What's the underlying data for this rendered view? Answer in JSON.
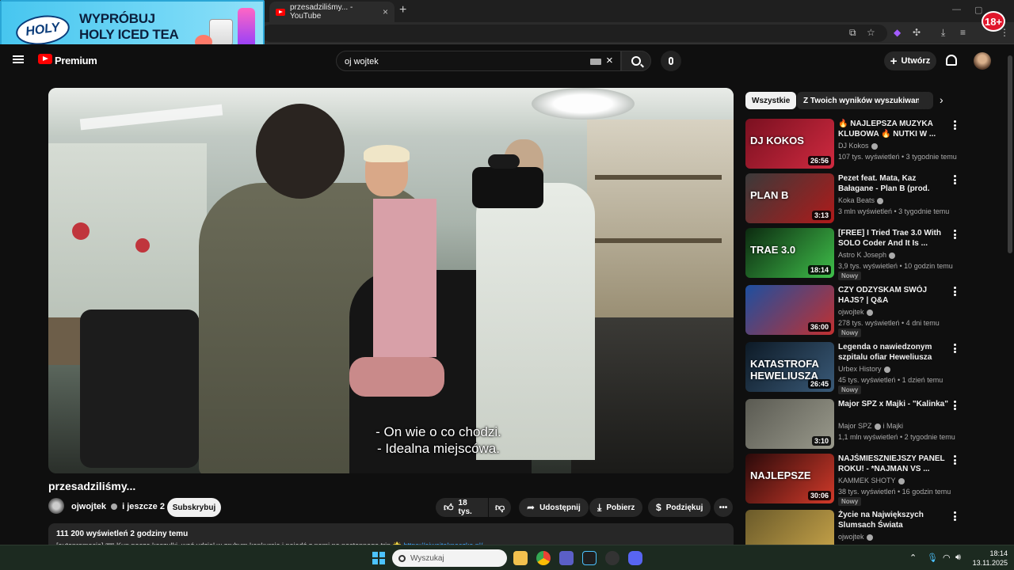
{
  "browser": {
    "tab_title": "przesadziliśmy... - YouTube",
    "new_tab": "+",
    "tab_close": "×"
  },
  "ad": {
    "logo_text": "HOLY",
    "headline_line1": "WYPRÓBUJ",
    "headline_line2": "HOLY ICED TEA",
    "age_badge": "18+"
  },
  "header": {
    "brand_label": "Premium",
    "search": {
      "value": "oj wojtek"
    },
    "create_label": "Utwórz"
  },
  "video": {
    "subtitles": [
      "- On wie o co chodzi.",
      "- Idealna miejscówa."
    ],
    "title": "przesadziliśmy...",
    "channel": "ojwojtek",
    "collab_suffix": "i jeszcze 2",
    "subscribe_label": "Subskrybuj",
    "likes": "18 tys.",
    "share_label": "Udostępnij",
    "download_label": "Pobierz",
    "thanks_label": "Podziękuj",
    "description_stats": "111 200 wyświetleń  2 godziny temu",
    "description_text": "[autopromocja] 🎟 Kup paczę koszulki, weź udział w grubym konkursie i pojedź z nami na następnego trip 🌟",
    "description_link": "https://ojwojtekpaczka.pl/"
  },
  "sidebar": {
    "chips": [
      "Wszystkie",
      "Z Twoich wyników wyszukiwania"
    ],
    "recommendations": [
      {
        "title": "🔥 NAJLEPSZA MUZYKA KLUBOWA 🔥 NUTKI W ...",
        "channel": "DJ Kokos",
        "meta": "107 tys. wyświetleń • 3 tygodnie temu",
        "duration": "26:56",
        "badge": "",
        "thumb_text": "DJ KOKOS",
        "colors": [
          "#7a1020",
          "#d02a40"
        ]
      },
      {
        "title": "Pezet feat. Mata, Kaz Bałagane - Plan B (prod. Pedro, Frenkie G)",
        "channel": "Koka Beats",
        "meta": "3 mln wyświetleń • 3 tygodnie temu",
        "duration": "3:13",
        "badge": "",
        "thumb_text": "PLAN B",
        "colors": [
          "#3a3a3a",
          "#b01a1a"
        ]
      },
      {
        "title": "[FREE] I Tried Trae 3.0 With SOLO Coder And It Is ...",
        "channel": "Astro K Joseph",
        "meta": "3,9 tys. wyświetleń • 10 godzin temu",
        "duration": "18:14",
        "badge": "Nowy",
        "thumb_text": "TRAE 3.0",
        "colors": [
          "#0c2a10",
          "#3fbf4a"
        ]
      },
      {
        "title": "CZY ODZYSKAM SWÓJ HAJS? | Q&A",
        "channel": "ojwojtek",
        "meta": "278 tys. wyświetleń • 4 dni temu",
        "duration": "36:00",
        "badge": "Nowy",
        "thumb_text": "",
        "colors": [
          "#1d4fa0",
          "#c23030"
        ]
      },
      {
        "title": "Legenda o nawiedzonym szpitalu ofiar Heweliusza",
        "channel": "Urbex History",
        "meta": "45 tys. wyświetleń • 1 dzień temu",
        "duration": "26:45",
        "badge": "Nowy",
        "thumb_text": "KATASTROFA HEWELIUSZA",
        "colors": [
          "#0d1a26",
          "#3a5a78"
        ]
      },
      {
        "title": "Major SPZ x Majki - \"Kalinka\"",
        "channel": "Major SPZ",
        "channel_suffix": "i Majki",
        "meta": "1,1 mln wyświetleń • 2 tygodnie temu",
        "duration": "3:10",
        "badge": "",
        "thumb_text": "",
        "colors": [
          "#5a5a52",
          "#9a9a8c"
        ]
      },
      {
        "title": "NAJŚMIESZNIEJSZY PANEL ROKU! - *NAJMAN VS ...",
        "channel": "KAMMEK SHOTY",
        "meta": "38 tys. wyświetleń • 16 godzin temu",
        "duration": "30:06",
        "badge": "Nowy",
        "thumb_text": "NAJLEPSZE",
        "colors": [
          "#2a0a0a",
          "#d23a2a"
        ]
      },
      {
        "title": "Życie na Największych Slumsach Świata",
        "channel": "ojwojtek",
        "meta": "",
        "duration": "",
        "badge": "",
        "thumb_text": "",
        "colors": [
          "#6a5a2a",
          "#caa64a"
        ]
      }
    ]
  },
  "taskbar": {
    "search_placeholder": "Wyszukaj",
    "time": "18:14",
    "date": "13.11.2025"
  }
}
